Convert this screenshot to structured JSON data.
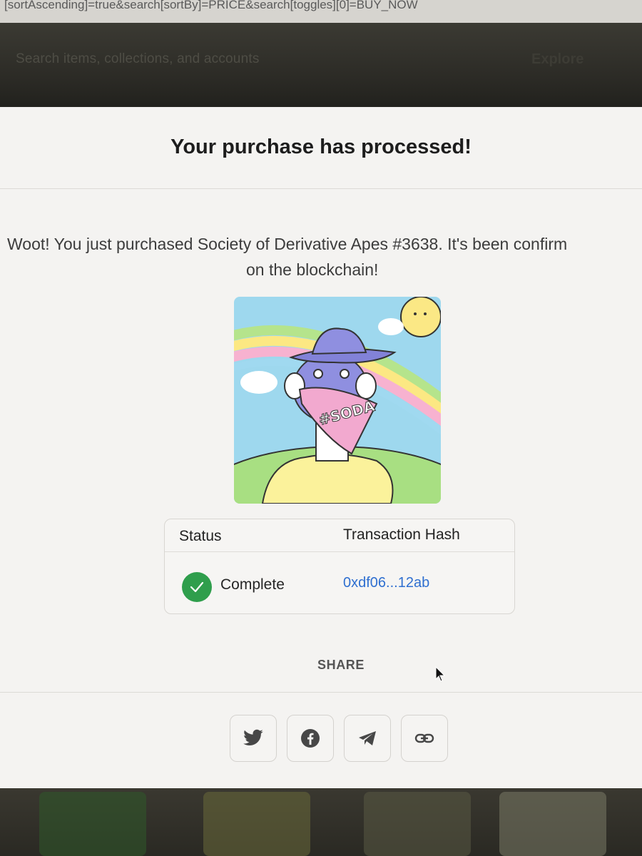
{
  "browser": {
    "url_fragment": "[sortAscending]=true&search[sortBy]=PRICE&search[toggles][0]=BUY_NOW"
  },
  "page_header": {
    "search_placeholder": "Search items, collections, and accounts",
    "nav_explore": "Explore"
  },
  "modal": {
    "title": "Your purchase has processed!",
    "message_line1": "Woot! You just purchased Society of Derivative Apes #3638. It's been confirm",
    "message_line2": "on the blockchain!",
    "nft_badge_text": "#SODA",
    "table": {
      "headers": [
        "Status",
        "Transaction Hash"
      ],
      "status_value": "Complete",
      "hash_value": "0xdf06...12ab"
    },
    "share_label": "SHARE",
    "share_buttons": [
      {
        "name": "twitter",
        "icon": "twitter-icon"
      },
      {
        "name": "facebook",
        "icon": "facebook-icon"
      },
      {
        "name": "telegram",
        "icon": "telegram-icon"
      },
      {
        "name": "copy-link",
        "icon": "link-icon"
      }
    ]
  },
  "colors": {
    "accent_link": "#2f6fd0",
    "success": "#2f9e4c",
    "modal_bg": "#f4f3f1"
  }
}
